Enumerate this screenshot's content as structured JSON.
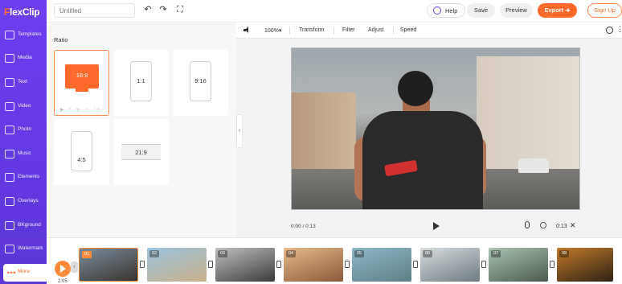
{
  "app": {
    "logo_text_f": "F",
    "logo_text_rest": "lexClip",
    "accent": "#ff6a2a",
    "brand_purple": "#6c3ef0"
  },
  "sidebar": {
    "items": [
      {
        "label": "Templates",
        "icon": "templates-icon"
      },
      {
        "label": "Media",
        "icon": "media-icon"
      },
      {
        "label": "Text",
        "icon": "text-icon"
      },
      {
        "label": "Video",
        "icon": "video-icon"
      },
      {
        "label": "Photo",
        "icon": "photo-icon"
      },
      {
        "label": "Music",
        "icon": "music-icon"
      },
      {
        "label": "Elements",
        "icon": "elements-icon"
      },
      {
        "label": "Overlays",
        "icon": "overlays-icon"
      },
      {
        "label": "BKground",
        "icon": "background-icon"
      },
      {
        "label": "Watermark",
        "icon": "watermark-icon"
      },
      {
        "label": "More",
        "icon": "more-dots-icon"
      }
    ]
  },
  "topbar": {
    "title_placeholder": "Untitled",
    "undo_icon": "↶",
    "redo_icon": "↷",
    "fullscreen_icon": "⛶",
    "help_label": "Help",
    "save_label": "Save",
    "preview_label": "Preview",
    "export_label": "Export ➔",
    "signup_label": "Sign Up"
  },
  "panel": {
    "title": "Ratio",
    "ratios": [
      {
        "label": "16:9",
        "selected": true
      },
      {
        "label": "1:1",
        "selected": false
      },
      {
        "label": "9:16",
        "selected": false
      },
      {
        "label": "4:5",
        "selected": false
      },
      {
        "label": "21:9",
        "selected": false
      }
    ],
    "social_icons": "▶ f ◎ ♫ in",
    "collapse_icon": "‹"
  },
  "edit_toolbar": {
    "zoom": "100%▾",
    "transform": "Transform",
    "filter": "Filter",
    "adjust": "Adjust",
    "speed": "Speed",
    "more_icon": "⋮"
  },
  "player": {
    "current_time": "0:00 / 0:13",
    "duration": "0:13",
    "close_icon": "✕"
  },
  "timeline": {
    "total_time": "2:05",
    "nav_left": "‹",
    "nav_right": "›",
    "clips": [
      {
        "num": "01",
        "selected": true,
        "color_a": "#7a8c9a",
        "color_b": "#3a3430"
      },
      {
        "num": "02",
        "selected": false,
        "color_a": "#9bc4de",
        "color_b": "#c9b08a"
      },
      {
        "num": "03",
        "selected": false,
        "color_a": "#bfbfbf",
        "color_b": "#3c3c3c"
      },
      {
        "num": "04",
        "selected": false,
        "color_a": "#e9b88a",
        "color_b": "#8a5a3a"
      },
      {
        "num": "05",
        "selected": false,
        "color_a": "#8fb8c8",
        "color_b": "#5d7f86"
      },
      {
        "num": "06",
        "selected": false,
        "color_a": "#d9dde0",
        "color_b": "#6d7a80"
      },
      {
        "num": "07",
        "selected": false,
        "color_a": "#a9c3b4",
        "color_b": "#4b5a4c"
      },
      {
        "num": "08",
        "selected": false,
        "color_a": "#c07a2a",
        "color_b": "#2f2214"
      }
    ]
  }
}
